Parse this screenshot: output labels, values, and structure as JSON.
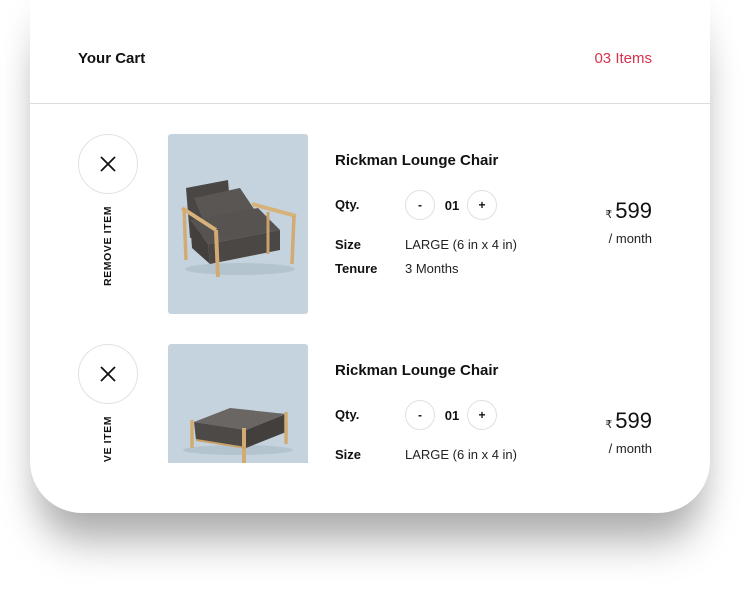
{
  "header": {
    "title": "Your Cart",
    "item_count": "03 Items"
  },
  "colors": {
    "accent": "#d6334c",
    "thumb_bg": "#c4d3dd"
  },
  "items": [
    {
      "remove_label": "REMOVE ITEM",
      "remove_icon": "close-icon",
      "image": "lounge-chair",
      "name": "Rickman Lounge Chair",
      "qty_label": "Qty.",
      "qty_minus": "-",
      "qty_value": "01",
      "qty_plus": "+",
      "size_label": "Size",
      "size_value": "LARGE (6 in x 4 in)",
      "tenure_label": "Tenure",
      "tenure_value": "3 Months",
      "currency": "₹",
      "price": "599",
      "period": "/ month"
    },
    {
      "remove_label": "REMOVE ITEM",
      "remove_icon": "close-icon",
      "image": "ottoman",
      "name": "Rickman Lounge Chair",
      "qty_label": "Qty.",
      "qty_minus": "-",
      "qty_value": "01",
      "qty_plus": "+",
      "size_label": "Size",
      "size_value": "LARGE (6 in x 4 in)",
      "currency": "₹",
      "price": "599",
      "period": "/ month"
    }
  ]
}
